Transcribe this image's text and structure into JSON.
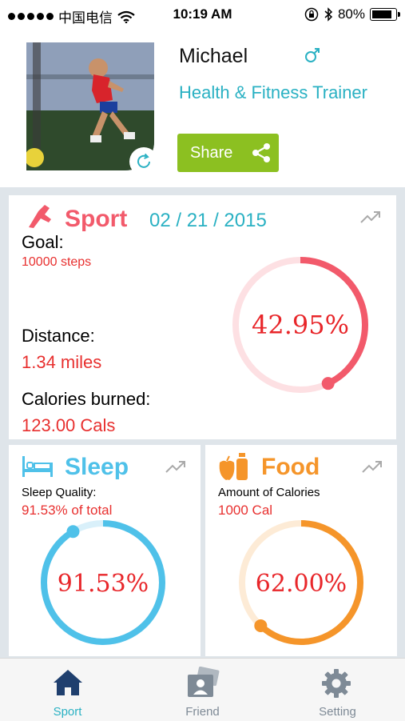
{
  "status_bar": {
    "carrier": "中国电信",
    "time": "10:19 AM",
    "battery": "80%",
    "battery_level": 0.8,
    "icons": [
      "signal-dots-icon",
      "wifi-icon",
      "orientation-lock-icon",
      "bluetooth-icon",
      "battery-icon"
    ]
  },
  "profile": {
    "name": "Michael",
    "gender_icon": "male-icon",
    "role": "Health & Fitness Trainer",
    "share_label": "Share",
    "share_icon": "share-icon",
    "refresh_icon": "refresh-icon"
  },
  "sport": {
    "title": "Sport",
    "date": "02 / 21 / 2015",
    "goal_label": "Goal:",
    "goal_value": "10000 steps",
    "distance_label": "Distance:",
    "distance_value": "1.34 miles",
    "calories_label": "Calories burned:",
    "calories_value": "123.00 Cals",
    "percent_text": "42.95%",
    "progress": 0.4295,
    "color": "#f25a6b",
    "icon": "shoe-icon"
  },
  "sleep": {
    "title": "Sleep",
    "quality_label": "Sleep Quality:",
    "quality_value": "91.53% of total",
    "percent_text": "91.53%",
    "progress": 0.9153,
    "color": "#4fc1e9",
    "icon": "bed-icon"
  },
  "food": {
    "title": "Food",
    "amount_label": "Amount of Calories",
    "amount_value": "1000 Cal",
    "percent_text": "62.00%",
    "progress": 0.62,
    "color": "#f5952a",
    "icon": "apple-bottle-icon"
  },
  "tabs": [
    {
      "label": "Sport",
      "icon": "home-icon",
      "active": true
    },
    {
      "label": "Friend",
      "icon": "contact-card-icon",
      "active": false
    },
    {
      "label": "Setting",
      "icon": "gear-icon",
      "active": false
    }
  ],
  "colors": {
    "accent_teal": "#2ab1c3",
    "share_green": "#8cc021",
    "value_red": "#e8302f",
    "tab_active": "#1f3f6e",
    "tab_inactive": "#7e8a96"
  }
}
